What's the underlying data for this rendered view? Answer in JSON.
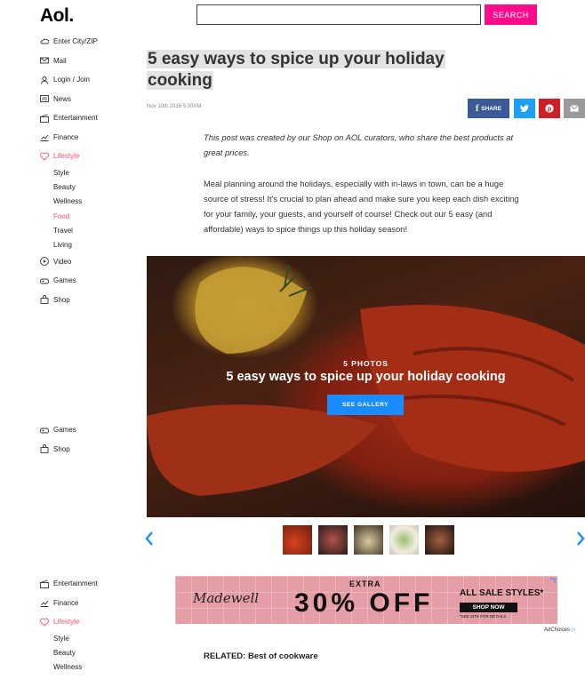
{
  "header": {
    "logo": "Aol.",
    "search_placeholder": "",
    "search_button": "SEARCH"
  },
  "colors": {
    "accent": "#ff0b8b",
    "lifestyle": "#ff4f6b",
    "gallery_button": "#1a8cff"
  },
  "nav_top": {
    "items": [
      {
        "label": "Enter City/ZIP",
        "icon": "weather-icon"
      },
      {
        "label": "Mail",
        "icon": "mail-icon"
      },
      {
        "label": "Login / Join",
        "icon": "user-icon"
      },
      {
        "label": "News",
        "icon": "news-icon"
      },
      {
        "label": "Entertainment",
        "icon": "clapper-icon"
      },
      {
        "label": "Finance",
        "icon": "chart-icon"
      },
      {
        "label": "Lifestyle",
        "icon": "heart-icon"
      }
    ],
    "sub": [
      "Style",
      "Beauty",
      "Wellness",
      "Food",
      "Travel",
      "Living"
    ],
    "after": [
      {
        "label": "Video",
        "icon": "play-icon"
      },
      {
        "label": "Games",
        "icon": "gamepad-icon"
      },
      {
        "label": "Shop",
        "icon": "bag-icon"
      }
    ]
  },
  "nav_mid": [
    {
      "label": "Games",
      "icon": "gamepad-icon"
    },
    {
      "label": "Shop",
      "icon": "bag-icon"
    }
  ],
  "nav_bottom": {
    "items": [
      {
        "label": "Entertainment",
        "icon": "clapper-icon"
      },
      {
        "label": "Finance",
        "icon": "chart-icon"
      },
      {
        "label": "Lifestyle",
        "icon": "heart-icon"
      }
    ],
    "sub": [
      "Style",
      "Beauty",
      "Wellness"
    ]
  },
  "article": {
    "headline_line1": "5 easy ways to spice up your holiday",
    "headline_line2": "cooking",
    "timestamp": "Nov 10th 2016 5:00AM",
    "share_label": "SHARE",
    "intro": "This post was created by our Shop on AOL curators, who share the best products at great prices.",
    "body": "Meal planning around the holidays, especially with in-laws in town, can be a huge source of stress! It's crucial to plan ahead and make sure you keep each dish exciting for your family, your guests, and yourself of course! Check out our 5 easy (and affordable) ways to spice things up this holiday season!",
    "related": "RELATED: Best of cookware"
  },
  "gallery": {
    "count": "5 PHOTOS",
    "title": "5 easy ways to spice up your holiday cooking",
    "button": "SEE GALLERY",
    "thumbs": [
      "lobster-thumb",
      "steak-thumb",
      "bowl-thumb",
      "cake-thumb",
      "dish-thumb"
    ]
  },
  "ad": {
    "brand": "Madewell",
    "extra": "EXTRA",
    "off": "30% OFF",
    "styles": "ALL SALE STYLES*",
    "shop": "SHOP NOW",
    "note": "*SEE SITE FOR DETAILS",
    "adchoices": "AdChoices"
  }
}
